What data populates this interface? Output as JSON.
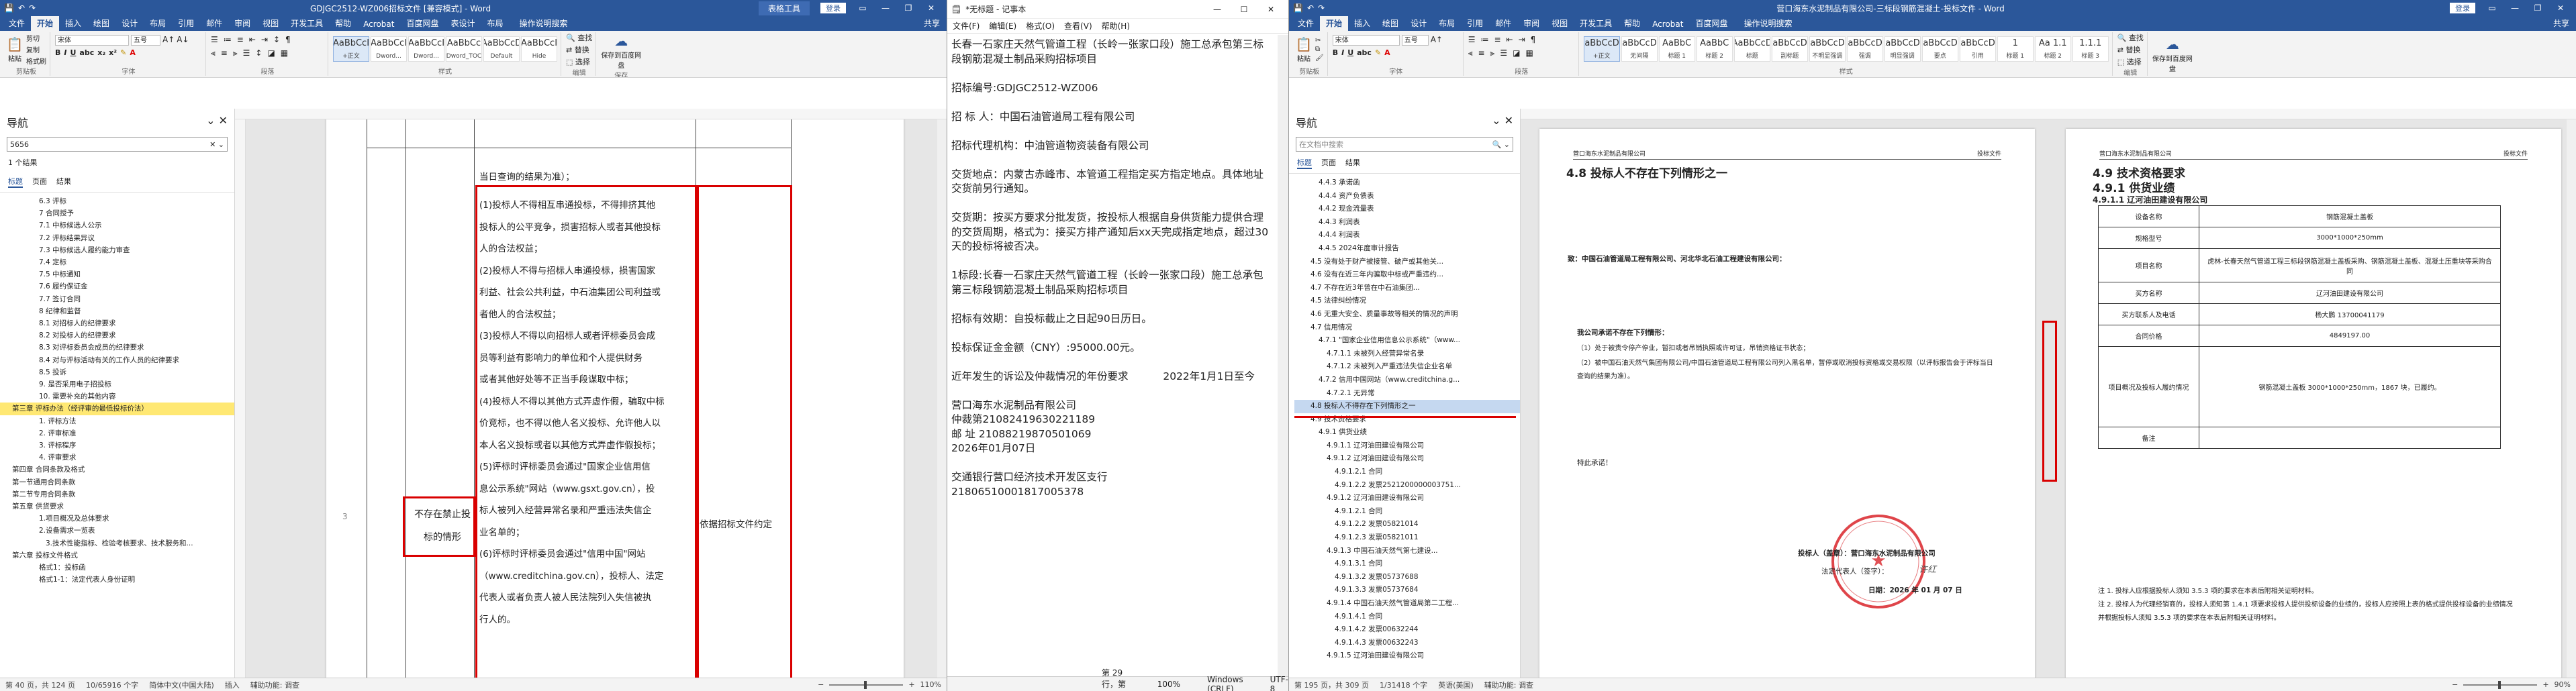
{
  "word_left": {
    "title": "GDJGC2512-WZ006招标文件 [兼容模式] - Word",
    "context_tab": "表格工具",
    "login": "登录",
    "tabs": [
      "文件",
      "开始",
      "插入",
      "绘图",
      "设计",
      "布局",
      "引用",
      "邮件",
      "审阅",
      "视图",
      "开发工具",
      "帮助",
      "Acrobat",
      "百度网盘",
      "表设计",
      "布局",
      "操作说明搜索"
    ],
    "share": "共享",
    "ribbon": {
      "paste": "粘贴",
      "cut": "剪切",
      "copy": "复制",
      "format_painter": "格式刷",
      "clipboard": "剪贴板",
      "font_name": "宋体",
      "font_size": "五号",
      "font_group": "字体",
      "para_group": "段落",
      "styles_group": "样式",
      "editing_group": "编辑",
      "styles": [
        {
          "sample": "AaBbCcI",
          "name": "+正文"
        },
        {
          "sample": "AaBbCcI",
          "name": "Dword..."
        },
        {
          "sample": "AaBbCcI",
          "name": "Dword..."
        },
        {
          "sample": "AaBbCc",
          "name": "Dword_TOC"
        },
        {
          "sample": "AaBbCcD",
          "name": "Default"
        },
        {
          "sample": "AaBbCcI",
          "name": "Hide"
        }
      ],
      "find": "查找",
      "replace": "替换",
      "select": "选择",
      "save_baidu": "保存到百度网盘",
      "save_label": "保存"
    },
    "nav": {
      "title": "导航",
      "search_value": "5656",
      "result_count": "1 个结果",
      "tabs": [
        "标题",
        "页面",
        "结果"
      ],
      "items": [
        "6.3 评标",
        "7 合同授予",
        "7.1 中标候选人公示",
        "7.2 评标结果异议",
        "7.3 中标候选人履约能力审查",
        "7.4 定标",
        "7.5 中标通知",
        "7.6 履约保证金",
        "7.7 签订合同",
        "8 纪律和监督",
        "8.1 对招标人的纪律要求",
        "8.2 对投标人的纪律要求",
        "8.3 对评标委员会成员的纪律要求",
        "8.4 对与评标活动有关的工作人员的纪律要求",
        "8.5 投诉",
        "9. 是否采用电子招投标",
        "10. 需要补充的其他内容",
        "第三章 评标办法（经评审的最低投标价法）",
        "1. 评标方法",
        "2. 评审标准",
        "3. 评标程序",
        "4. 评审要求",
        "第四章 合同条款及格式",
        "第一节通用合同条款",
        "第二节专用合同条款",
        "第五章 供货要求",
        "1.项目概况及总体要求",
        "2.设备需求一览表",
        "3.技术性能指标、检验考核要求、技术服务和...",
        "第六章 投标文件格式",
        "格式1：投标函",
        "格式1-1：法定代表人身份证明"
      ]
    },
    "table": {
      "intro": "当日查询的结果为准）；",
      "item_label": "不存在禁止投标的情形",
      "col3_lines": [
        "(1)投标人不得相互串通投标，不得排挤其他",
        "投标人的公平竞争，损害招标人或者其他投标",
        "人的合法权益；",
        "(2)投标人不得与招标人串通投标，损害国家",
        "利益、社会公共利益，中石油集团公司利益或",
        "者他人的合法权益；",
        "(3)投标人不得以向招标人或者评标委员会成",
        "员等利益有影响力的单位和个人提供财务",
        "或者其他好处等不正当手段谋取中标；",
        "(4)投标人不得以其他方式弄虚作假，骗取中标",
        "价竞标，也不得以他人名义投标、允许他人以",
        "本人名义投标或者以其他方式弄虚作假投标；",
        "(5)评标时评标委员会通过\"国家企业信用信",
        "息公示系统\"网站（www.gsxt.gov.cn），投",
        "标人被列入经营异常名录和严重违法失信企",
        "业名单的；",
        "(6)评标时评标委员会通过\"信用中国\"网站",
        "（www.creditchina.gov.cn），投标人、法定",
        "代表人或者负责人被人民法院列入失信被执",
        "行人的。"
      ],
      "col4": "依据招标文件约定"
    },
    "status": {
      "page": "第 40 页，共 124 页",
      "words": "10/65916 个字",
      "lang": "简体中文(中国大陆)",
      "insert": "插入",
      "access": "辅助功能: 调查",
      "zoom": "110%"
    }
  },
  "notepad": {
    "title": "*无标题 - 记事本",
    "menu": [
      "文件(F)",
      "编辑(E)",
      "格式(O)",
      "查看(V)",
      "帮助(H)"
    ],
    "text": "长春一石家庄天然气管道工程（长岭一张家口段）施工总承包第三标段钢筋混凝土制品采购招标项目\n\n招标编号:GDJGC2512-WZ006\n\n招 标 人：中国石油管道局工程有限公司\n\n招标代理机构：中油管道物资装备有限公司\n\n交货地点：内蒙古赤峰市、本管道工程指定买方指定地点。具体地址交货前另行通知。\n\n交货期：按买方要求分批发货，按投标人根据自身供货能力提供合理的交货周期，格式为：接买方排产通知后xx天完成指定地点，超过30天的投标将被否决。\n\n1标段:长春一石家庄天然气管道工程（长岭一张家口段）施工总承包第三标段钢筋混凝土制品采购招标项目\n\n招标有效期：自投标截止之日起90日历日。\n\n投标保证金金额（CNY）:95000.00元。\n\n近年发生的诉讼及仲裁情况的年份要求\t\t2022年1月1日至今\n\n营口海东水泥制品有限公司\n仲裁第21082419630221189\n邮 址 21088219870501069\n2026年01月07日\n\n交通银行营口经济技术开发区支行\n21806510001817005378",
    "status": {
      "pos": "第 29 行，第 1 列",
      "zoom": "100%",
      "eol": "Windows (CRLF)",
      "enc": "UTF-8"
    }
  },
  "word_right": {
    "title": "营口海东水泥制品有限公司-三标段钢筋混凝土-投标文件 - Word",
    "login": "登录",
    "tabs": [
      "文件",
      "开始",
      "插入",
      "绘图",
      "设计",
      "布局",
      "引用",
      "邮件",
      "审阅",
      "视图",
      "开发工具",
      "帮助",
      "Acrobat",
      "百度网盘",
      "操作说明搜索"
    ],
    "share": "共享",
    "ribbon": {
      "paste": "粘贴",
      "clipboard": "剪贴板",
      "font_name": "宋体",
      "font_size": "五号",
      "font_group": "字体",
      "para_group": "段落",
      "styles_group": "样式",
      "editing_group": "编辑",
      "styles": [
        {
          "sample": "AaBbCcDd",
          "name": "+正文"
        },
        {
          "sample": "AaBbCcDd",
          "name": "无间隔"
        },
        {
          "sample": "AaBbC",
          "name": "标题 1"
        },
        {
          "sample": "AaBbC",
          "name": "标题 2"
        },
        {
          "sample": "AaBbCcD",
          "name": "标题"
        },
        {
          "sample": "AaBbCcDd",
          "name": "副标题"
        },
        {
          "sample": "AaBbCcDd",
          "name": "不明显强调"
        },
        {
          "sample": "AaBbCcDd",
          "name": "强调"
        },
        {
          "sample": "AaBbCcDd",
          "name": "明显强调"
        },
        {
          "sample": "AaBbCcDd",
          "name": "要点"
        },
        {
          "sample": "AaBbCcDd",
          "name": "引用"
        },
        {
          "sample": "1",
          "name": "标题 1"
        },
        {
          "sample": "Aa 1.1",
          "name": "标题 2"
        },
        {
          "sample": "1.1.1",
          "name": "标题 3"
        }
      ],
      "find": "查找",
      "replace": "替换",
      "select": "选择",
      "save_baidu": "保存到百度网盘"
    },
    "nav": {
      "title": "导航",
      "search_placeholder": "在文档中搜索",
      "tabs": [
        "标题",
        "页面",
        "结果"
      ],
      "items": [
        "4.4.3 承诺函",
        "4.4.4 资产负债表",
        "4.4.2 现金流量表",
        "4.4.3 利润表",
        "4.4.4 利润表",
        "4.4.5 2024年度审计报告",
        "4.5 没有处于财产被接管、破产或其他关...",
        "4.6 没有在近三年内骗取中标或严重违约...",
        "4.7 不存在近3年曾在中石油集团...",
        "4.5 法律纠纷情况",
        "4.6 无重大安全、质量事故等相关的情况的声明",
        "4.7 信用情况",
        "4.7.1 \"国家企业信用信息公示系统\"（www...",
        "4.7.1.1 未被列入经营异常名录",
        "4.7.1.2 未被列入严重违法失信企业名单",
        "4.7.2 信用中国网站（www.creditchina.g...",
        "4.7.2.1 无异常",
        "4.8 投标人不得存在下列情形之一",
        "4.9 技术资格要求",
        "4.9.1 供货业绩",
        "4.9.1.1 辽河油田建设有限公司",
        "4.9.1.2 辽河油田建设有限公司",
        "4.9.1.2.1 合同",
        "4.9.1.2.2 发票2521200000003751...",
        "4.9.1.2 辽河油田建设有限公司",
        "4.9.1.2.1 合同",
        "4.9.1.2.2 发票05821014",
        "4.9.1.2.3 发票05821011",
        "4.9.1.3 中国石油天然气第七建设...",
        "4.9.1.3.1 合同",
        "4.9.1.3.2 发票05737688",
        "4.9.1.3.3 发票05737684",
        "4.9.1.4 中国石油天然气管道局第二工程...",
        "4.9.1.4.1 合同",
        "4.9.1.4.2 发票00632244",
        "4.9.1.4.3 发票00632243",
        "4.9.1.5 辽河油田建设有限公司"
      ],
      "selected_index": 17
    },
    "page1": {
      "header_left": "营口海东水泥制品有限公司",
      "header_right": "投标文件",
      "heading": "4.8 投标人不存在下列情形之一",
      "to_line": "致：中国石油管道局工程有限公司、河北华北石油工程建设有限公司：",
      "decl_title": "我公司承诺不存在下列情形：",
      "decl_1": "（1）处于被责令停产停业，暂扣或者吊销执照或许可证，吊销资格证书状态；",
      "decl_2": "（2）被中国石油天然气集团有限公司/中国石油管道局工程有限公司列入黑名单，暂停或取消投标资格或交易权限（以评标报告会于评标当日查询的结果为准）。",
      "note": "特此承诺！",
      "bidder_label": "投标人（盖章）：营口海东水泥制品有限公司",
      "rep_label": "法定代表人（签字）：",
      "date_label": "日期：2026 年 01 月 07 日",
      "signature": "许红"
    },
    "page2": {
      "header_left": "营口海东水泥制品有限公司",
      "header_right": "投标文件",
      "h1": "4.9 技术资格要求",
      "h2": "4.9.1 供货业绩",
      "h3": "4.9.1.1 辽河油田建设有限公司",
      "rows": [
        {
          "k": "设备名称",
          "v": "钢筋混凝土盖板"
        },
        {
          "k": "规格型号",
          "v": "3000*1000*250mm"
        },
        {
          "k": "项目名称",
          "v": "虎林-长春天然气管道工程三标段钢筋混凝土盖板采购、钢筋混凝土盖板、混凝土压重块等采购合同"
        },
        {
          "k": "买方名称",
          "v": "辽河油田建设有限公司"
        },
        {
          "k": "买方联系人及电话",
          "v": "杨大鹏 13700041179"
        },
        {
          "k": "合同价格",
          "v": "4849197.00"
        },
        {
          "k": "项目概况及投标人履约情况",
          "v": "钢筋混凝土盖板 3000*1000*250mm，1867 块，已履约。"
        },
        {
          "k": "备注",
          "v": ""
        }
      ],
      "note1": "注 1. 投标人应根据投标人须知 3.5.3 项的要求在本表后附相关证明材料。",
      "note2": "注 2. 投标人为代理经销商的，投标人须知第 1.4.1 项要求投标人提供投标设备的业绩的，投标人应按照上表的格式提供投标设备的业绩情况并根据投标人须知 3.5.3 项的要求在本表后附相关证明材料。"
    },
    "status": {
      "page": "第 195 页，共 309 页",
      "words": "1/31418 个字",
      "lang": "英语(美国)",
      "access": "辅助功能: 调查",
      "zoom": "90%"
    }
  },
  "colors": {
    "word_blue": "#2b579a",
    "highlight_red": "#d90000",
    "nav_highlight": "#ffe873",
    "stamp_red": "#d9252a"
  }
}
